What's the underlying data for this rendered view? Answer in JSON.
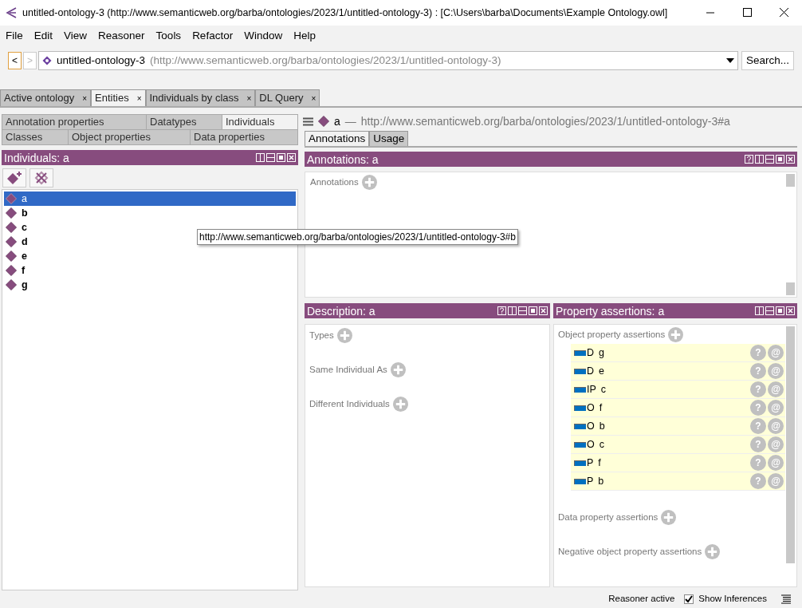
{
  "window": {
    "title": "untitled-ontology-3 (http://www.semanticweb.org/barba/ontologies/2023/1/untitled-ontology-3)  : [C:\\Users\\barba\\Documents\\Example Ontology.owl]"
  },
  "menu": [
    "File",
    "Edit",
    "View",
    "Reasoner",
    "Tools",
    "Refactor",
    "Window",
    "Help"
  ],
  "nav": {
    "back": {
      "label": "<",
      "disabled": false
    },
    "forward": {
      "label": ">",
      "disabled": true
    },
    "ontology_name": "untitled-ontology-3",
    "ontology_iri": "(http://www.semanticweb.org/barba/ontologies/2023/1/untitled-ontology-3)",
    "search_button": "Search..."
  },
  "tabs": [
    {
      "label": "Active ontology",
      "close": "×",
      "selected": false
    },
    {
      "label": "Entities",
      "close": "×",
      "selected": true
    },
    {
      "label": "Individuals by class",
      "close": "×",
      "selected": false
    },
    {
      "label": "DL Query",
      "close": "×",
      "selected": false
    }
  ],
  "entity_tabs": [
    [
      {
        "label": "Annotation properties",
        "selected": false
      },
      {
        "label": "Datatypes",
        "selected": false
      },
      {
        "label": "Individuals",
        "selected": true
      }
    ],
    [
      {
        "label": "Classes",
        "selected": false
      },
      {
        "label": "Object properties",
        "selected": false
      },
      {
        "label": "Data properties",
        "selected": false
      }
    ]
  ],
  "individuals_panel": {
    "title": "Individuals: a",
    "items": [
      {
        "label": "a",
        "selected": true
      },
      {
        "label": "b",
        "selected": false
      },
      {
        "label": "c",
        "selected": false
      },
      {
        "label": "d",
        "selected": false
      },
      {
        "label": "e",
        "selected": false
      },
      {
        "label": "f",
        "selected": false
      },
      {
        "label": "g",
        "selected": false
      }
    ]
  },
  "tooltip": "http://www.semanticweb.org/barba/ontologies/2023/1/untitled-ontology-3#b",
  "entity_header": {
    "name": "a",
    "separator": "—",
    "iri": "http://www.semanticweb.org/barba/ontologies/2023/1/untitled-ontology-3#a"
  },
  "entity_view_tabs": [
    {
      "label": "Annotations",
      "selected": true
    },
    {
      "label": "Usage",
      "selected": false
    }
  ],
  "annotations_panel": {
    "title": "Annotations: a",
    "sections": [
      "Annotations"
    ]
  },
  "description_panel": {
    "title": "Description: a",
    "sections": [
      "Types",
      "Same Individual As",
      "Different Individuals"
    ]
  },
  "property_panel": {
    "title": "Property assertions: a",
    "object_section": "Object property assertions",
    "assertions": [
      {
        "property": "D",
        "value": "g",
        "buttons": [
          "?",
          "@"
        ]
      },
      {
        "property": "D",
        "value": "e",
        "buttons": [
          "?",
          "@"
        ]
      },
      {
        "property": "IP",
        "value": "c",
        "buttons": [
          "?",
          "@"
        ]
      },
      {
        "property": "O",
        "value": "f",
        "buttons": [
          "?",
          "@"
        ]
      },
      {
        "property": "O",
        "value": "b",
        "buttons": [
          "?",
          "@"
        ]
      },
      {
        "property": "O",
        "value": "c",
        "buttons": [
          "?",
          "@"
        ]
      },
      {
        "property": "P",
        "value": "f",
        "buttons": [
          "?",
          "@"
        ]
      },
      {
        "property": "P",
        "value": "b",
        "buttons": [
          "?",
          "@"
        ]
      }
    ],
    "other_sections": [
      "Data property assertions",
      "Negative object property assertions"
    ]
  },
  "status_bar": {
    "reasoner": "Reasoner active",
    "show_inferences": {
      "label": "Show Inferences",
      "checked": true
    }
  }
}
